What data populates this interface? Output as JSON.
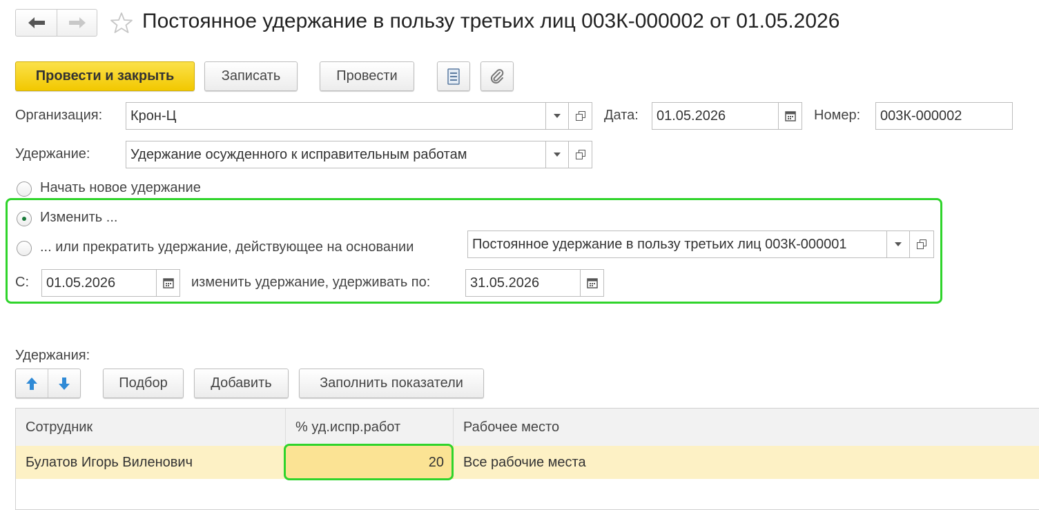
{
  "window": {
    "title": "Постоянное удержание в пользу третьих лиц 003К-000002 от 01.05.2026"
  },
  "toolbar": {
    "post_close": "Провести и закрыть",
    "save": "Записать",
    "post": "Провести"
  },
  "form": {
    "org_label": "Организация:",
    "org_value": "Крон-Ц",
    "date_label": "Дата:",
    "date_value": "01.05.2026",
    "number_label": "Номер:",
    "number_value": "003К-000002",
    "deduction_label": "Удержание:",
    "deduction_value": "Удержание осужденного к исправительным работам",
    "radio_new": "Начать новое удержание",
    "radio_change": "Изменить ...",
    "radio_stop": "... или прекратить удержание, действующее на основании",
    "basis_value": "Постоянное удержание в пользу третьих лиц 003К-000001",
    "from_label": "С:",
    "from_value": "01.05.2026",
    "until_label": "изменить удержание, удерживать по:",
    "until_value": "31.05.2026"
  },
  "table_section": {
    "label": "Удержания:",
    "buttons": {
      "select": "Подбор",
      "add": "Добавить",
      "fill": "Заполнить показатели"
    },
    "columns": [
      "Сотрудник",
      "% уд.испр.работ",
      "Рабочее место"
    ],
    "rows": [
      [
        "Булатов Игорь Виленович",
        "20",
        "Все рабочие места"
      ]
    ]
  },
  "colors": {
    "primary_button": "#f2c800",
    "highlight": "#2fd42b",
    "selected_row": "#fdf1c5"
  }
}
